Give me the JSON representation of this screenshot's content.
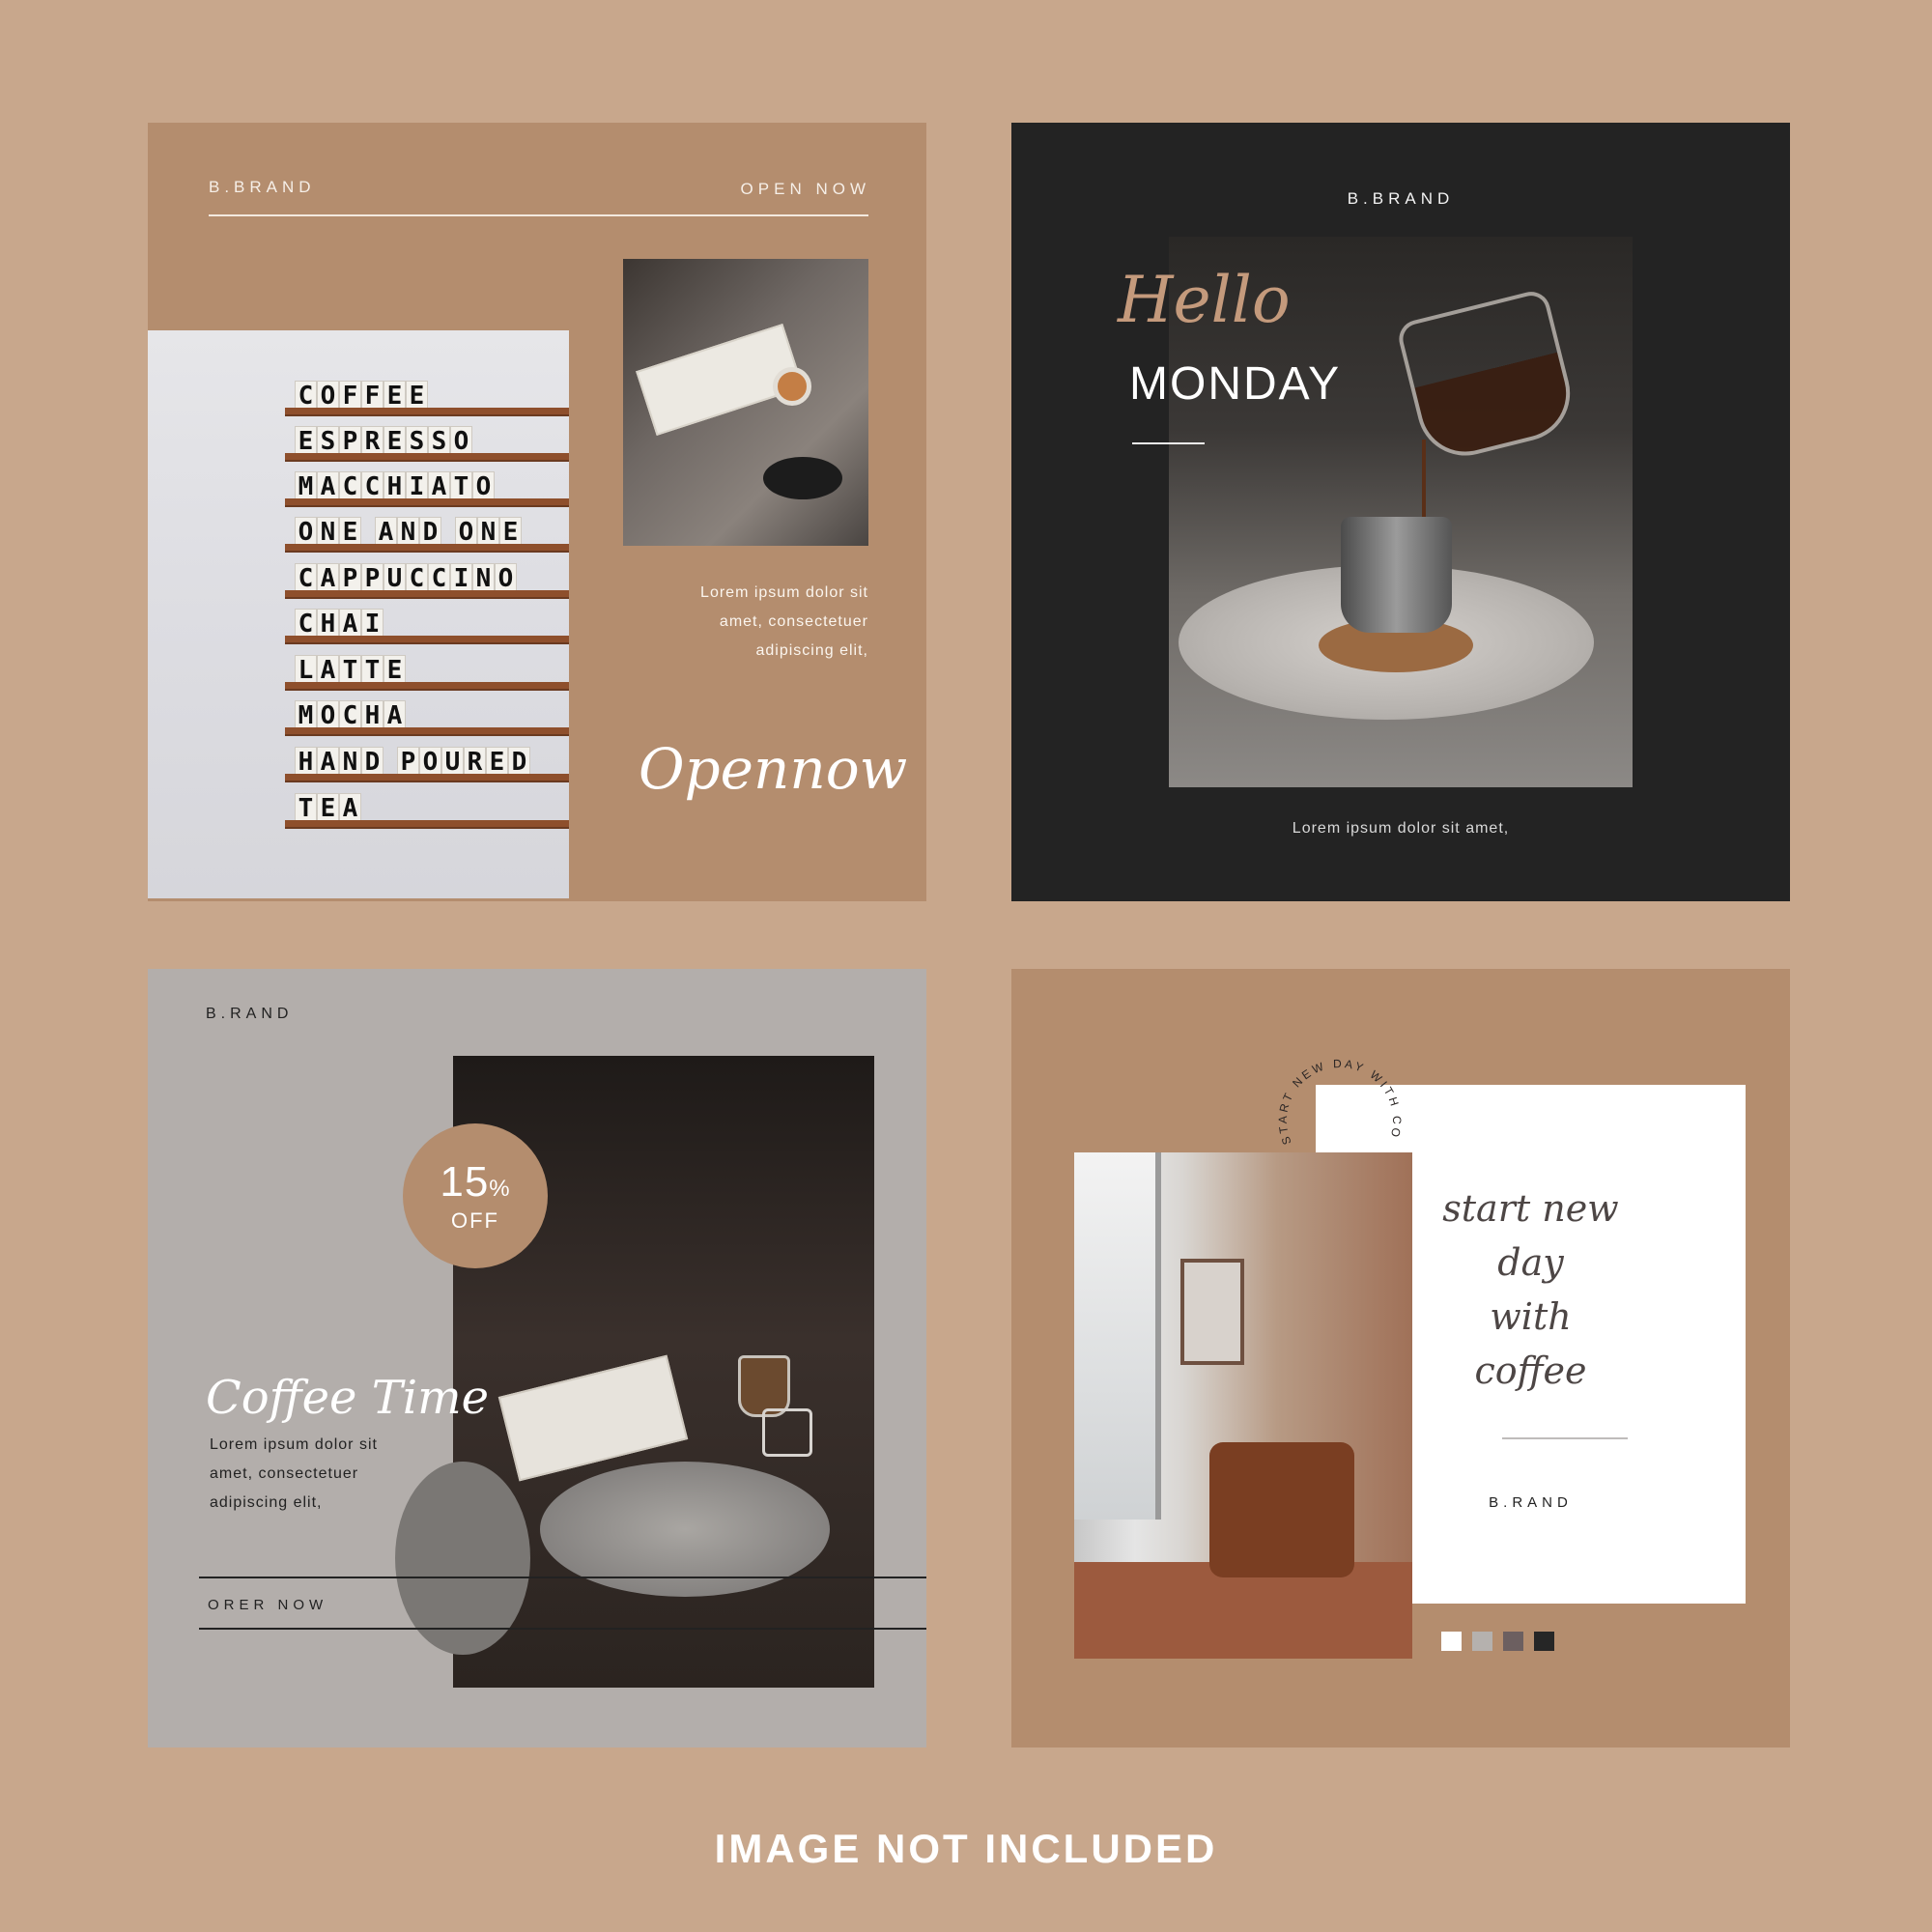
{
  "card1": {
    "brand": "B.BRAND",
    "status": "OPEN NOW",
    "menu_items": [
      "COFFEE",
      "ESPRESSO",
      "MACCHIATO",
      "ONE AND ONE",
      "CAPPUCCINO",
      "CHAI",
      "LATTE",
      "MOCHA",
      "HAND POURED",
      "TEA"
    ],
    "body_lines": [
      "Lorem ipsum dolor sit",
      "amet, consectetuer",
      "adipiscing elit,"
    ],
    "script": "Opennow"
  },
  "card2": {
    "brand": "B.BRAND",
    "script": "Hello",
    "title": "MONDAY",
    "caption": "Lorem ipsum dolor sit amet,"
  },
  "card3": {
    "brand": "B.RAND",
    "badge_value": "15",
    "badge_unit": "%",
    "badge_label": "OFF",
    "script": "Coffee Time",
    "body_lines": [
      "Lorem ipsum dolor sit",
      "amet, consectetuer",
      "adipiscing elit,"
    ],
    "cta": "ORER NOW"
  },
  "card4": {
    "arc_text": "START NEW DAY WITH COFFEE",
    "script_lines": [
      "start new",
      "day",
      "with",
      "coffee"
    ],
    "brand": "B.RAND",
    "swatches": [
      "#ffffff",
      "#b5b1ae",
      "#6c5f60",
      "#262626"
    ]
  },
  "footer": "IMAGE NOT INCLUDED"
}
